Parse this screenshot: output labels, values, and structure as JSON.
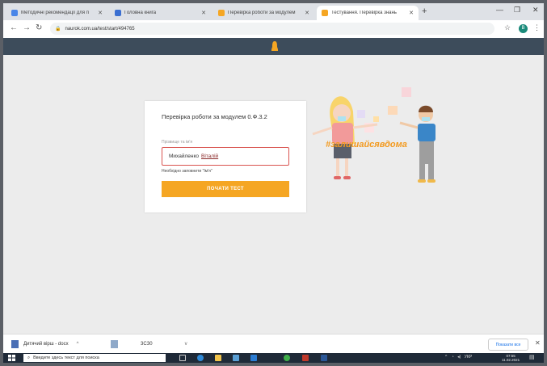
{
  "browser": {
    "tabs": [
      {
        "title": "Методичні рекомендації для п",
        "active": false
      },
      {
        "title": "Головна книга",
        "active": false
      },
      {
        "title": "Перевірка роботи за модулем",
        "active": false
      },
      {
        "title": "Тестування. Перевірка знань",
        "active": true
      }
    ],
    "url": "naurok.com.ua/test/start/494765"
  },
  "test_card": {
    "title": "Перевірка роботи за модулем 0.Ф.3.2",
    "name_label": "Прізвище та ім'я",
    "name_first": "Михайленко",
    "name_second": "Віталій",
    "error_text": "Необхідно заповнити \"Ім'я\"",
    "start_button": "ПОЧАТИ ТЕСТ"
  },
  "illustration": {
    "hashtag": "#залишайсявдома"
  },
  "download_bar": {
    "item1": "Дитячий вірш - docx",
    "item2": "3СЗ0",
    "show_all": "Показати все"
  },
  "taskbar": {
    "search_placeholder": "Введите здесь текст для поиска",
    "tray_lang": "УКР",
    "time": "07:55",
    "date": "11.02.2021"
  },
  "colors": {
    "accent": "#f5a623",
    "header": "#3d4c5b",
    "error_border": "#d9534f"
  }
}
